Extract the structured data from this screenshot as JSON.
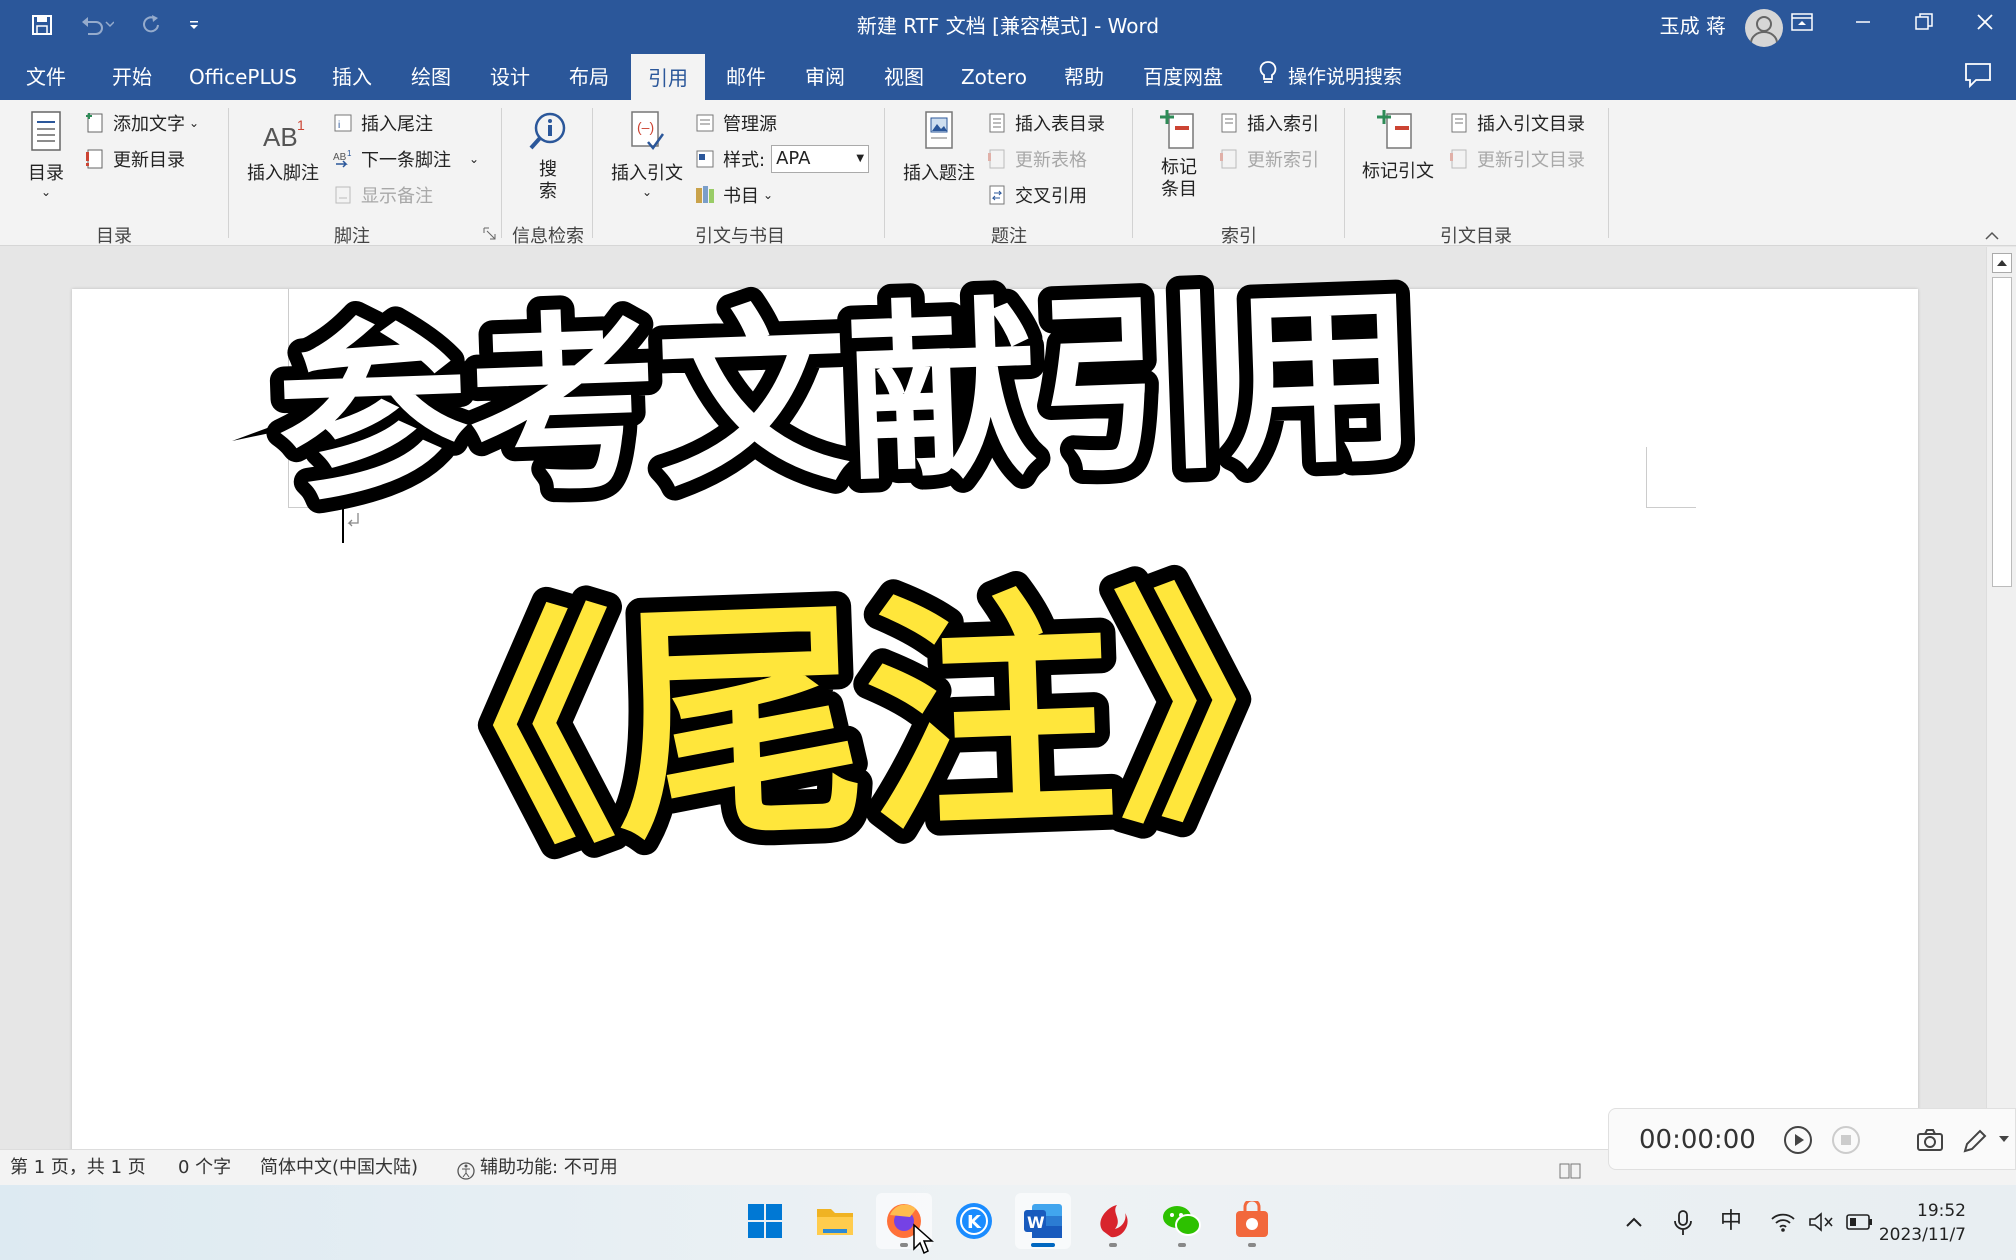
{
  "titlebar": {
    "document_title": "新建 RTF 文档 [兼容模式]  -  Word",
    "user_name": "玉成 蒋",
    "quick_access": [
      "save-icon",
      "undo-icon",
      "redo-icon",
      "customize-icon"
    ]
  },
  "tabs": [
    {
      "label": "文件",
      "active": false
    },
    {
      "label": "开始",
      "active": false
    },
    {
      "label": "OfficePLUS",
      "active": false
    },
    {
      "label": "插入",
      "active": false
    },
    {
      "label": "绘图",
      "active": false
    },
    {
      "label": "设计",
      "active": false
    },
    {
      "label": "布局",
      "active": false
    },
    {
      "label": "引用",
      "active": true
    },
    {
      "label": "邮件",
      "active": false
    },
    {
      "label": "审阅",
      "active": false
    },
    {
      "label": "视图",
      "active": false
    },
    {
      "label": "Zotero",
      "active": false
    },
    {
      "label": "帮助",
      "active": false
    },
    {
      "label": "百度网盘",
      "active": false
    }
  ],
  "tell_me": "操作说明搜索",
  "ribbon": {
    "toc": {
      "group": "目录",
      "toc_button": "目录",
      "add_text": "添加文字",
      "update_toc": "更新目录"
    },
    "footnotes": {
      "group": "脚注",
      "insert_footnote": "插入脚注",
      "insert_endnote": "插入尾注",
      "next_footnote": "下一条脚注",
      "show_notes": "显示备注"
    },
    "research": {
      "group": "信息检索",
      "search": "搜索"
    },
    "citations": {
      "group": "引文与书目",
      "insert_citation": "插入引文",
      "manage_sources": "管理源",
      "style_label": "样式:",
      "style_value": "APA",
      "bibliography": "书目"
    },
    "captions": {
      "group": "题注",
      "insert_caption": "插入题注",
      "insert_table_of_figures": "插入表目录",
      "update_table": "更新表格",
      "cross_reference": "交叉引用"
    },
    "index": {
      "group": "索引",
      "mark_entry": "标记条目",
      "insert_index": "插入索引",
      "update_index": "更新索引"
    },
    "toa": {
      "group": "引文目录",
      "mark_citation": "标记引文",
      "insert_toa": "插入引文目录",
      "update_toa": "更新引文目录"
    }
  },
  "document": {
    "overlay_line1": "参考文献引用",
    "overlay_line2": "《尾注》"
  },
  "statusbar": {
    "page": "第 1 页，共 1 页",
    "words": "0 个字",
    "language": "简体中文(中国大陆)",
    "accessibility": "辅助功能: 不可用"
  },
  "recorder": {
    "time": "00:00:00"
  },
  "taskbar": {
    "apps": [
      "windows-start-icon",
      "file-explorer-icon",
      "firefox-icon",
      "kugou-icon",
      "word-icon",
      "app-red-icon",
      "wechat-icon",
      "app-bag-icon"
    ],
    "tray_ime": "中",
    "time": "19:52",
    "date": "2023/11/7"
  },
  "colors": {
    "word_blue": "#2b579a",
    "overlay_yellow": "#ffe63b"
  }
}
